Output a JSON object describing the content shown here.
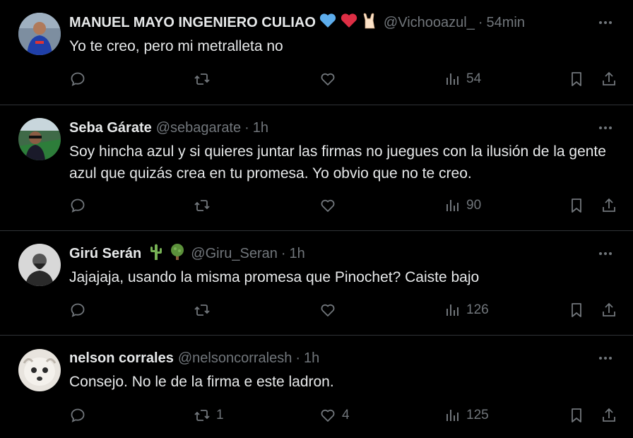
{
  "tweets": [
    {
      "name": "MANUEL MAYO INGENIERO CULIAO",
      "name_emojis": [
        "blue-heart",
        "red-heart",
        "rock-hand"
      ],
      "handle": "@Vichooazul_",
      "time": "54min",
      "text": "Yo te creo, pero mi metralleta no",
      "replies": "",
      "retweets": "",
      "likes": "",
      "views": "54"
    },
    {
      "name": "Seba Gárate",
      "name_emojis": [],
      "handle": "@sebagarate",
      "time": "1h",
      "text": "Soy hincha azul y si quieres juntar las firmas no juegues con la ilusión de la gente azul que quizás crea en tu promesa. Yo obvio que no te creo.",
      "replies": "",
      "retweets": "",
      "likes": "",
      "views": "90"
    },
    {
      "name": "Girú Serán",
      "name_emojis": [
        "cactus",
        "tree"
      ],
      "handle": "@Giru_Seran",
      "time": "1h",
      "text": "Jajajaja, usando la misma promesa que Pinochet? Caiste bajo",
      "replies": "",
      "retweets": "",
      "likes": "",
      "views": "126"
    },
    {
      "name": "nelson corrales",
      "name_emojis": [],
      "handle": "@nelsoncorralesh",
      "time": "1h",
      "text": "Consejo. No le de la firma e este ladron.",
      "replies": "",
      "retweets": "1",
      "likes": "4",
      "views": "125"
    }
  ],
  "separator": "·",
  "colors": {
    "background": "#000000",
    "text": "#e7e9ea",
    "muted": "#71767b",
    "divider": "#2f3336"
  }
}
